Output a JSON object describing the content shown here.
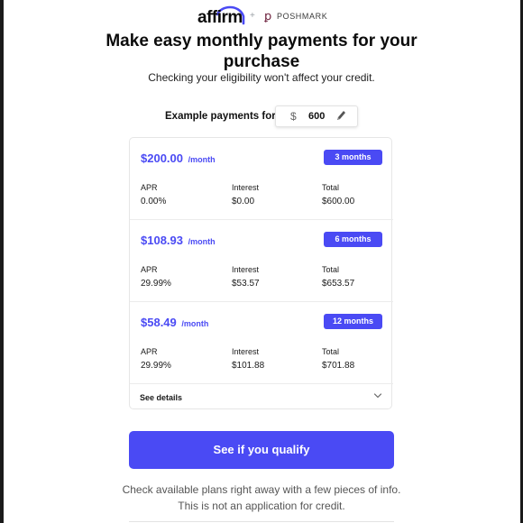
{
  "brand": {
    "affirm_logo_text": "affirm",
    "plus": "+",
    "partner_logo_text": "POSHMARK",
    "partner_icon": "poshmark-p-icon"
  },
  "headline": "Make easy monthly payments for your purchase",
  "subhead": "Checking your eligibility won't affect your credit.",
  "example": {
    "label": "Example payments for",
    "currency": "$",
    "amount": "600",
    "edit_icon": "pencil-icon"
  },
  "plans": [
    {
      "price": "$200.00",
      "per": "/month",
      "term": "3 months",
      "apr_label": "APR",
      "apr": "0.00%",
      "interest_label": "Interest",
      "interest": "$0.00",
      "total_label": "Total",
      "total": "$600.00"
    },
    {
      "price": "$108.93",
      "per": "/month",
      "term": "6 months",
      "apr_label": "APR",
      "apr": "29.99%",
      "interest_label": "Interest",
      "interest": "$53.57",
      "total_label": "Total",
      "total": "$653.57"
    },
    {
      "price": "$58.49",
      "per": "/month",
      "term": "12 months",
      "apr_label": "APR",
      "apr": "29.99%",
      "interest_label": "Interest",
      "interest": "$101.88",
      "total_label": "Total",
      "total": "$701.88"
    }
  ],
  "see_details": "See details",
  "cta_label": "See if you qualify",
  "footnote_line1": "Check available plans right away with a few pieces of info.",
  "footnote_line2": "This is not an application for credit.",
  "colors": {
    "accent": "#4a4af4",
    "poshmark": "#6b1d3a"
  }
}
